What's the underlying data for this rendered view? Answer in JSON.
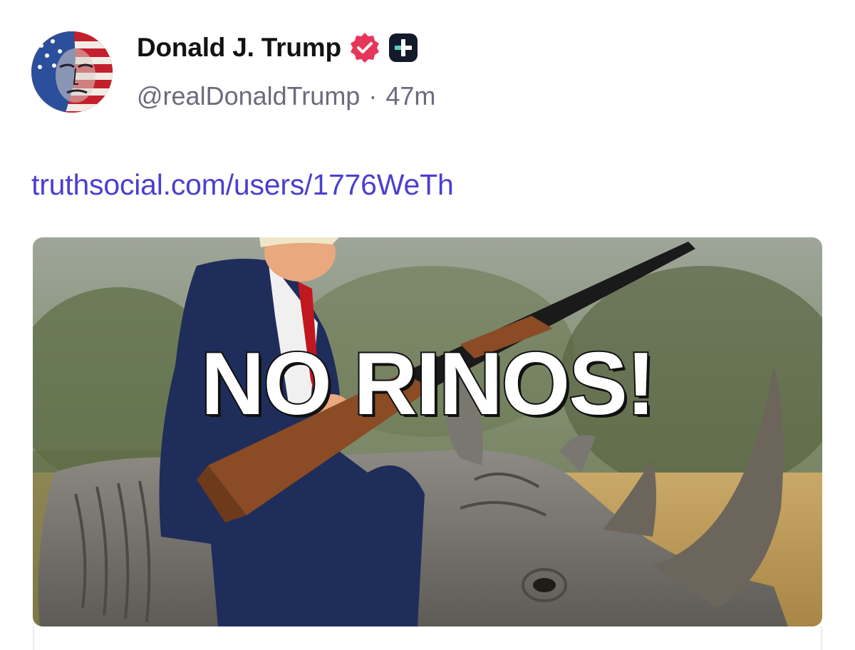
{
  "author": {
    "display_name": "Donald J. Trump",
    "handle": "@realDonaldTrump",
    "separator": "·",
    "timestamp": "47m",
    "verified_icon": "verified-badge-icon",
    "verified_color": "#e6375a",
    "plus_icon": "plus-badge-icon"
  },
  "post": {
    "link_text": "truthsocial.com/users/1776WeTh",
    "link_color": "#4b3fd0"
  },
  "media": {
    "overlay_text": "NO RINOS!"
  }
}
